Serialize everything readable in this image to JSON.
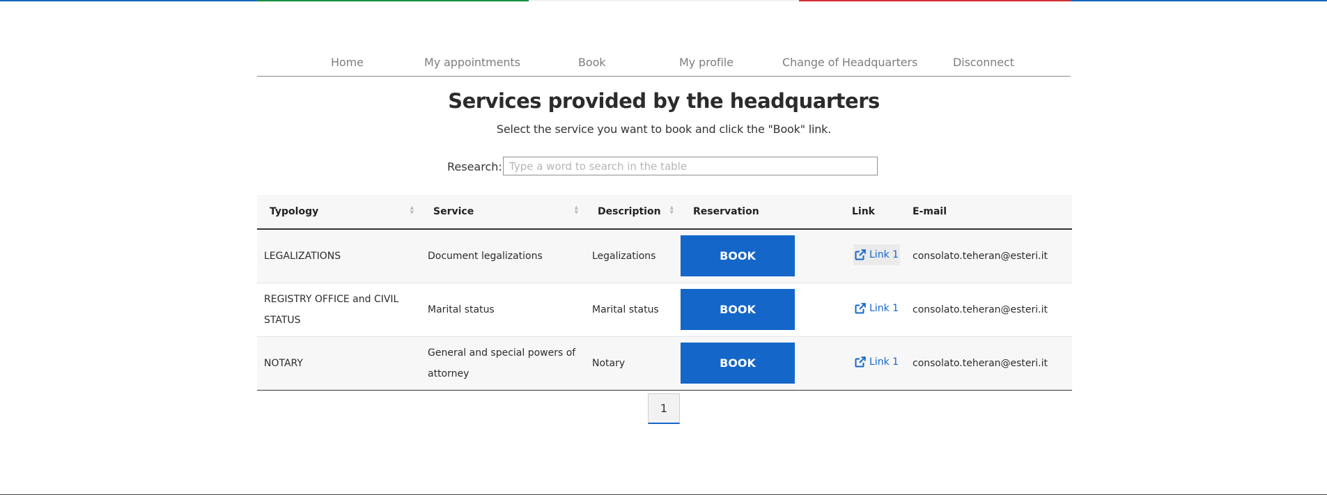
{
  "nav": {
    "items": [
      {
        "label": "Home"
      },
      {
        "label": "My appointments"
      },
      {
        "label": "Book"
      },
      {
        "label": "My profile"
      },
      {
        "label": "Change of Headquarters"
      },
      {
        "label": "Disconnect"
      }
    ]
  },
  "page": {
    "title": "Services provided by the headquarters",
    "subtitle": "Select the service you want to book and click the \"Book\" link."
  },
  "search": {
    "label": "Research:",
    "placeholder": "Type a word to search in the table",
    "value": ""
  },
  "table": {
    "headers": {
      "typology": "Typology",
      "service": "Service",
      "description": "Description",
      "reservation": "Reservation",
      "link": "Link",
      "email": "E-mail"
    },
    "rows": [
      {
        "typology": "LEGALIZATIONS",
        "service": "Document legalizations",
        "description": "Legalizations",
        "reservation": "BOOK",
        "link": "Link 1",
        "email": "consolato.teheran@esteri.it"
      },
      {
        "typology": "REGISTRY OFFICE and CIVIL STATUS",
        "service": "Marital status",
        "description": "Marital status",
        "reservation": "BOOK",
        "link": "Link 1",
        "email": "consolato.teheran@esteri.it"
      },
      {
        "typology": "NOTARY",
        "service": "General and special powers of attorney",
        "description": "Notary",
        "reservation": "BOOK",
        "link": "Link 1",
        "email": "consolato.teheran@esteri.it"
      }
    ]
  },
  "pagination": {
    "current_page": "1"
  },
  "icons": {
    "sort": "sort-icon",
    "external_link": "external-link-icon"
  },
  "colors": {
    "accent": "#1466c9",
    "flag_green": "#138f3f",
    "flag_red": "#d32f2f",
    "flag_blue": "#1565c0"
  }
}
